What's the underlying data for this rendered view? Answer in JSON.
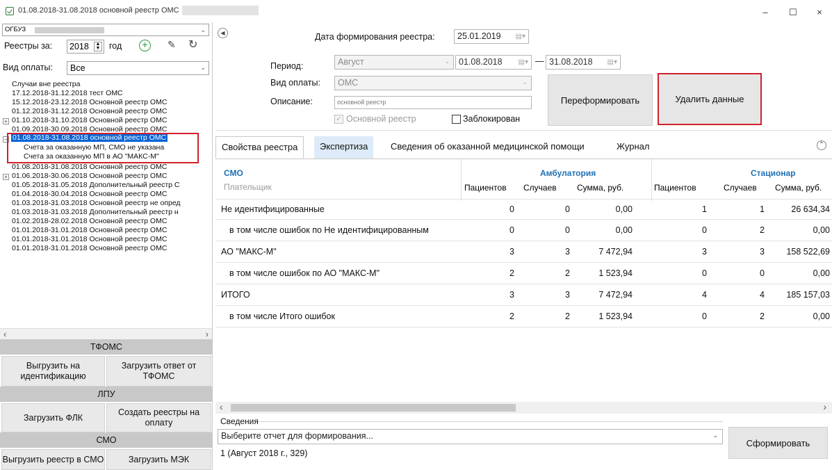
{
  "window": {
    "title": "01.08.2018-31.08.2018 основной реестр ОМС",
    "minimize": "–",
    "maximize": "☐",
    "close": "×"
  },
  "left": {
    "org": "ОГБУЗ",
    "registry_year_label": "Реестры за:",
    "registry_year": "2018",
    "year_word": "год",
    "payment_label": "Вид оплаты:",
    "payment_value": "Все",
    "tree": [
      {
        "text": "Случаи вне реестра"
      },
      {
        "text": "17.12.2018-31.12.2018 тест ОМС"
      },
      {
        "text": "15.12.2018-23.12.2018 Основной реестр ОМС"
      },
      {
        "text": "01.12.2018-31.12.2018 Основной реестр ОМС"
      },
      {
        "text": "01.10.2018-31.10.2018 Основной реестр ОМС"
      },
      {
        "text": "01.09.2018-30.09.2018 Основной реестр ОМС"
      },
      {
        "text": "01.08.2018-31.08.2018 основной реестр ОМС"
      },
      {
        "text": "Счета за оказанную МП, СМО не указана"
      },
      {
        "text": "Счета за оказанную МП в АО \"МАКС-М\""
      },
      {
        "text": "01.08.2018-31.08.2018 Основной реестр ОМС"
      },
      {
        "text": "01.06.2018-30.06.2018 Основной реестр ОМС"
      },
      {
        "text": "01.05.2018-31.05.2018 Дополнительный реестр С"
      },
      {
        "text": "01.04.2018-30.04.2018 Основной реестр ОМС"
      },
      {
        "text": "01.03.2018-31.03.2018 Основной реестр не опред"
      },
      {
        "text": "01.03.2018-31.03.2018 Дополнительный реестр н"
      },
      {
        "text": "01.02.2018-28.02.2018 Основной реестр ОМС"
      },
      {
        "text": "01.01.2018-31.01.2018 Основной реестр ОМС"
      },
      {
        "text": "01.01.2018-31.01.2018 Основной реестр ОМС"
      },
      {
        "text": "01.01.2018-31.01.2018 Основной реестр ОМС"
      }
    ],
    "tfoms_header": "ТФОМС",
    "btn_export_ident": "Выгрузить на идентификацию",
    "btn_load_tfoms": "Загрузить ответ от ТФОМС",
    "lpu_header": "ЛПУ",
    "btn_load_flk": "Загрузить ФЛК",
    "btn_create_payment": "Создать реестры на оплату",
    "smo_header": "СМО",
    "btn_export_smo": "Выгрузить реестр в СМО",
    "btn_load_mek": "Загрузить МЭК"
  },
  "form": {
    "date_label": "Дата формирования реестра:",
    "date_value": "25.01.2019",
    "period_label": "Период:",
    "period_value": "Август",
    "date_from": "01.08.2018",
    "dash": "—",
    "date_to": "31.08.2018",
    "payment_label": "Вид оплаты:",
    "payment_value": "ОМС",
    "desc_label": "Описание:",
    "desc_value": "основной реестр",
    "main_registry": "Основной реестр",
    "blocked": "Заблокирован",
    "btn_reform": "Переформировать",
    "btn_delete": "Удалить данные"
  },
  "tabs": [
    {
      "label": "Свойства реестра"
    },
    {
      "label": "Экспертиза"
    },
    {
      "label": "Сведения об оказанной медицинской помощи"
    },
    {
      "label": "Журнал"
    }
  ],
  "table": {
    "col_smo": "СМО",
    "col_payer": "Плательщик",
    "group_amb": "Амбулатория",
    "group_stac": "Стационар",
    "sub_patients": "Пациентов",
    "sub_cases": "Случаев",
    "sub_sum": "Сумма, руб.",
    "rows": [
      {
        "name": "Не идентифицированные",
        "a_p": "0",
        "a_c": "0",
        "a_s": "0,00",
        "s_p": "1",
        "s_c": "1",
        "s_s": "26 634,34"
      },
      {
        "name": "в том числе ошибок по Не идентифицированным",
        "a_p": "0",
        "a_c": "0",
        "a_s": "0,00",
        "s_p": "0",
        "s_c": "2",
        "s_s": "0,00"
      },
      {
        "name": "АО \"МАКС-М\"",
        "a_p": "3",
        "a_c": "3",
        "a_s": "7 472,94",
        "s_p": "3",
        "s_c": "3",
        "s_s": "158 522,69"
      },
      {
        "name": "в том числе ошибок по АО \"МАКС-М\"",
        "a_p": "2",
        "a_c": "2",
        "a_s": "1 523,94",
        "s_p": "0",
        "s_c": "0",
        "s_s": "0,00"
      },
      {
        "name": "ИТОГО",
        "a_p": "3",
        "a_c": "3",
        "a_s": "7 472,94",
        "s_p": "4",
        "s_c": "4",
        "s_s": "185 157,03"
      },
      {
        "name": "в том числе Итого ошибок",
        "a_p": "2",
        "a_c": "2",
        "a_s": "1 523,94",
        "s_p": "0",
        "s_c": "2",
        "s_s": "0,00"
      }
    ]
  },
  "bottom": {
    "section_label": "Сведения",
    "report_placeholder": "Выберите отчет для формирования...",
    "btn_generate": "Сформировать",
    "status": "1 (Август 2018 г., 329)"
  },
  "colors": {
    "accent_header": "#1f6fb5",
    "highlight_red": "#d0212b",
    "selection_blue": "#0a64d6"
  }
}
